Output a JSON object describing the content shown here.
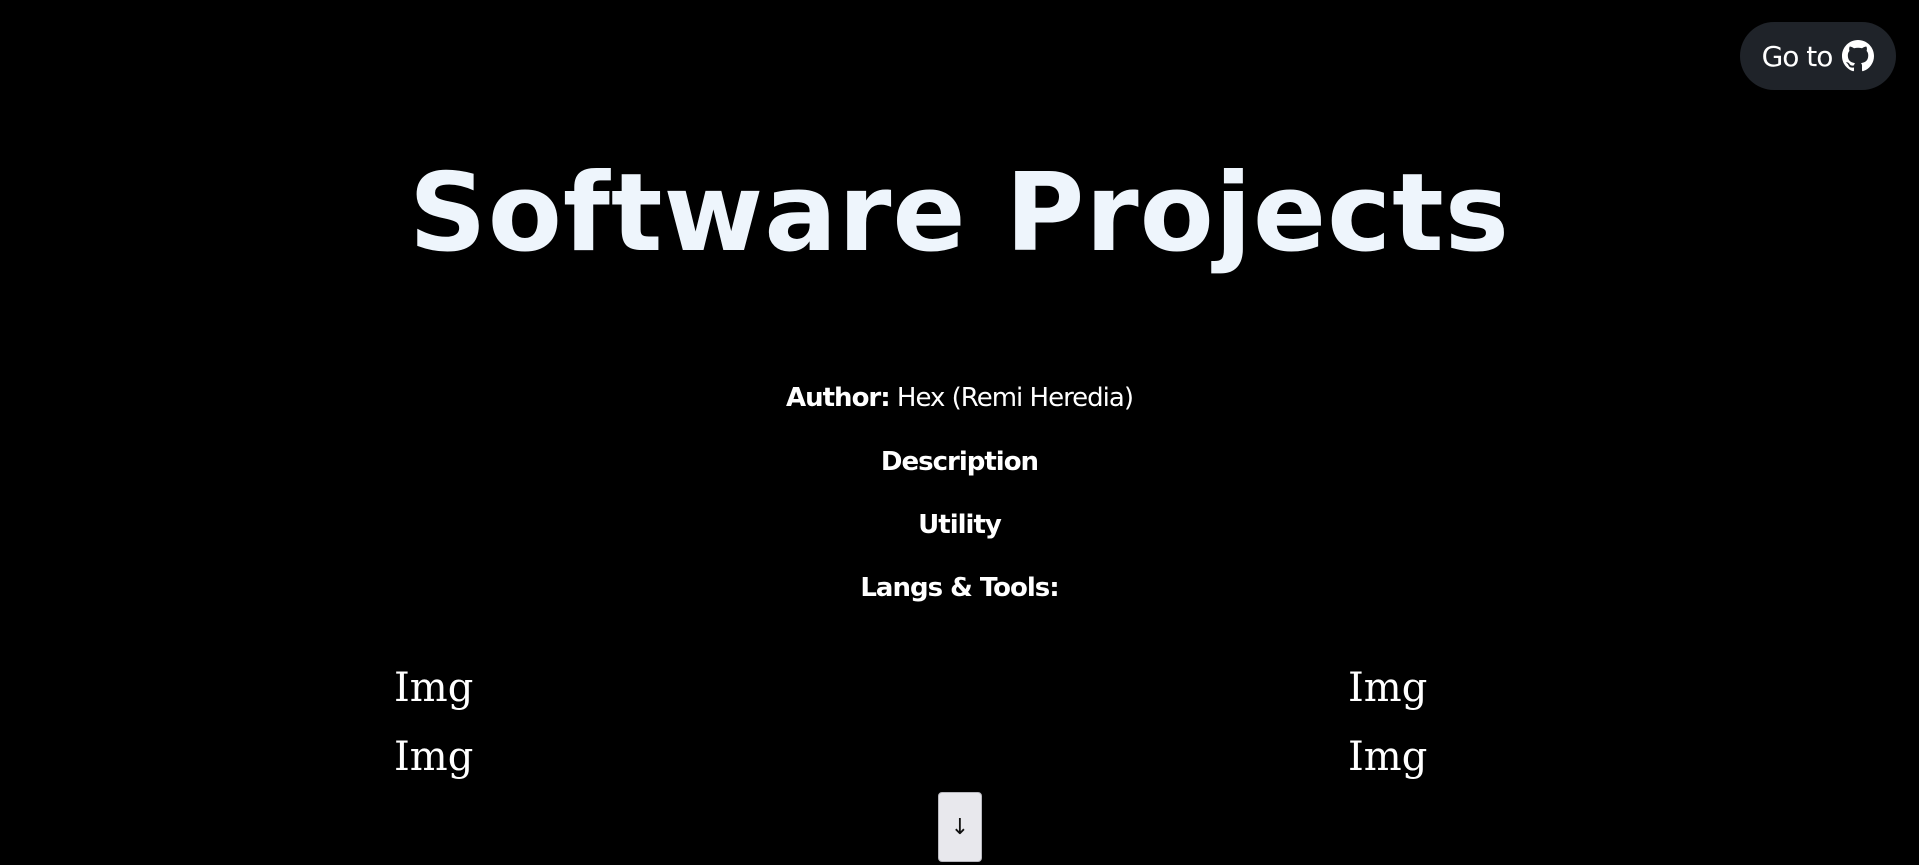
{
  "header": {
    "goto_label": "Go to",
    "goto_icon": "github-icon"
  },
  "main": {
    "title": "Software Projects",
    "author_label": "Author:",
    "author_value": "Hex (Remi Heredia)",
    "description_label": "Description",
    "utility_label": "Utility",
    "langs_label": "Langs & Tools:",
    "images": {
      "left": [
        "Img",
        "Img"
      ],
      "right": [
        "Img",
        "Img"
      ]
    },
    "scroll_button_glyph": "↓"
  },
  "colors": {
    "background": "#000000",
    "title": "#eef5fc",
    "button_bg": "#1f2329",
    "scroll_button_bg": "#e8e8ed"
  }
}
